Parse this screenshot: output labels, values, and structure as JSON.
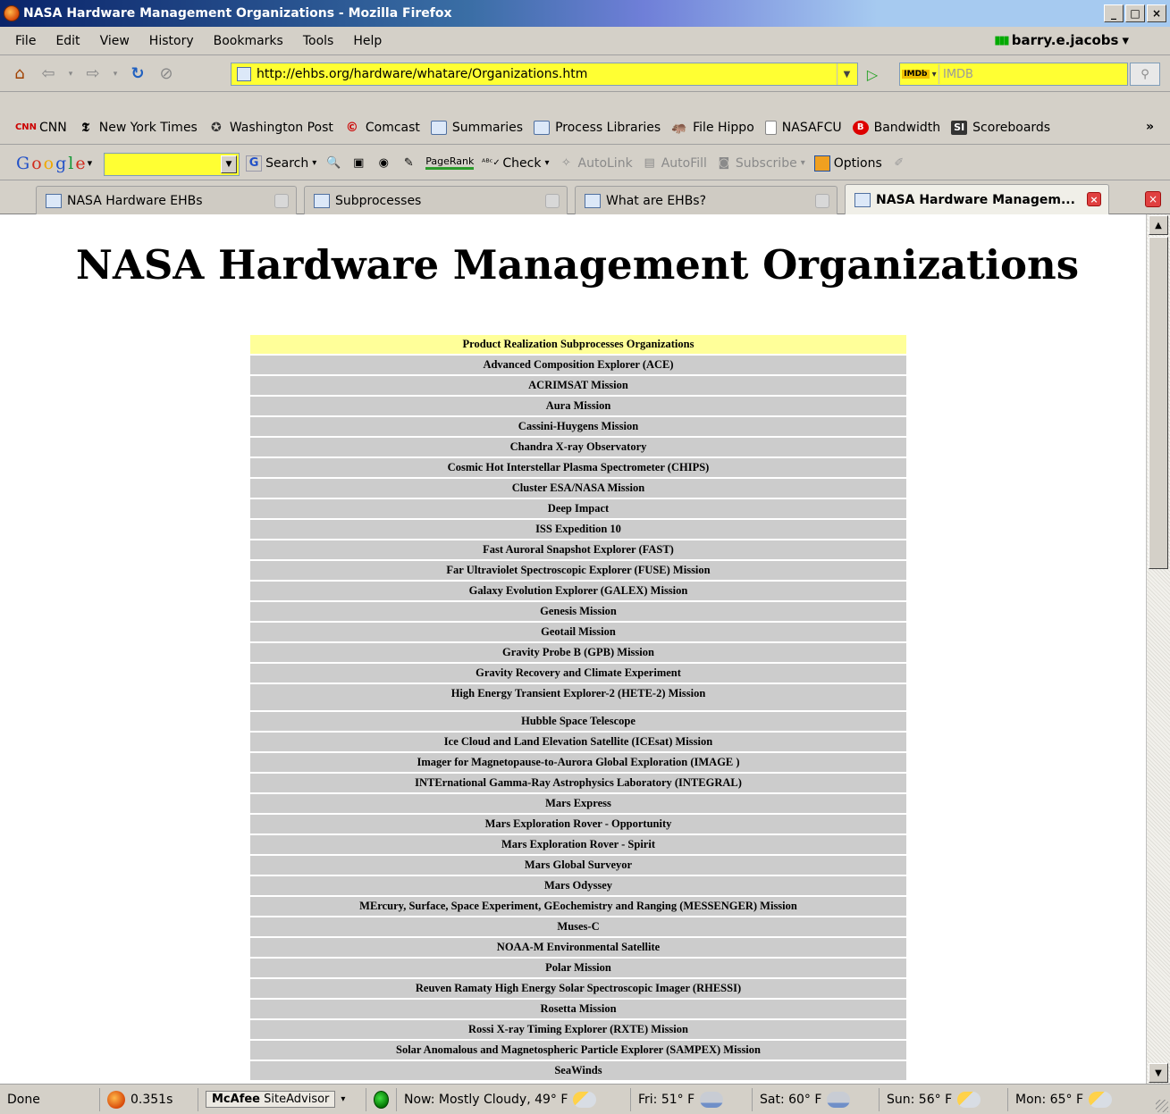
{
  "window": {
    "title": "NASA Hardware Management Organizations - Mozilla Firefox",
    "buttons": {
      "minimize": "_",
      "maximize": "□",
      "close": "×"
    }
  },
  "menubar": {
    "items": [
      "File",
      "Edit",
      "View",
      "History",
      "Bookmarks",
      "Tools",
      "Help"
    ],
    "user": "barry.e.jacobs"
  },
  "navbar": {
    "url": "http://ehbs.org/hardware/whatare/Organizations.htm",
    "search_placeholder": "IMDB",
    "search_engine_label": "IMDb"
  },
  "bookmarks": {
    "items": [
      {
        "label": "CNN",
        "icon": "cnn-icon"
      },
      {
        "label": "New York Times",
        "icon": "nyt-icon"
      },
      {
        "label": "Washington Post",
        "icon": "washington-post-icon"
      },
      {
        "label": "Comcast",
        "icon": "comcast-icon"
      },
      {
        "label": "Summaries",
        "icon": "page-icon"
      },
      {
        "label": "Process Libraries",
        "icon": "page-icon"
      },
      {
        "label": "File Hippo",
        "icon": "hippo-icon"
      },
      {
        "label": "NASAFCU",
        "icon": "document-icon"
      },
      {
        "label": "Bandwidth",
        "icon": "bandwidth-icon"
      },
      {
        "label": "Scoreboards",
        "icon": "si-icon"
      }
    ],
    "more": "»"
  },
  "google_toolbar": {
    "logo": [
      "G",
      "o",
      "o",
      "g",
      "l",
      "e"
    ],
    "search_label": "Search",
    "pagerank_label": "PageRank",
    "check_label": "Check",
    "autolink_label": "AutoLink",
    "autofill_label": "AutoFill",
    "subscribe_label": "Subscribe",
    "options_label": "Options"
  },
  "tabs": [
    {
      "label": "NASA Hardware EHBs",
      "active": false
    },
    {
      "label": "Subprocesses",
      "active": false
    },
    {
      "label": "What are EHBs?",
      "active": false
    },
    {
      "label": "NASA Hardware Managem...",
      "active": true
    }
  ],
  "page": {
    "title": "NASA Hardware Management Organizations",
    "table_header": "Product Realization Subprocesses Organizations",
    "organizations": [
      "Advanced Composition Explorer (ACE)",
      "ACRIMSAT Mission",
      "Aura Mission",
      "Cassini-Huygens Mission",
      "Chandra X-ray Observatory",
      "Cosmic Hot Interstellar Plasma Spectrometer (CHIPS)",
      "Cluster ESA/NASA Mission",
      "Deep Impact",
      "ISS Expedition 10",
      "Fast Auroral Snapshot Explorer (FAST)",
      "Far Ultraviolet Spectroscopic Explorer (FUSE) Mission",
      "Galaxy Evolution Explorer (GALEX) Mission",
      "Genesis Mission",
      "Geotail Mission",
      "Gravity Probe B (GPB) Mission",
      "Gravity Recovery and Climate Experiment",
      "High Energy Transient Explorer-2 (HETE-2) Mission",
      "Hubble Space Telescope",
      "Ice Cloud and Land Elevation Satellite (ICEsat) Mission",
      "Imager for Magnetopause-to-Aurora Global Exploration (IMAGE )",
      "INTErnational Gamma-Ray Astrophysics Laboratory (INTEGRAL)",
      "Mars Express",
      "Mars Exploration Rover - Opportunity",
      "Mars Exploration Rover - Spirit",
      "Mars Global Surveyor",
      "Mars Odyssey",
      "MErcury, Surface, Space Experiment, GEochemistry and Ranging (MESSENGER) Mission",
      "Muses-C",
      "NOAA-M Environmental Satellite",
      "Polar Mission",
      "Reuven Ramaty High Energy Solar Spectroscopic Imager (RHESSI)",
      "Rosetta Mission",
      "Rossi X-ray Timing Explorer (RXTE) Mission",
      "Solar Anomalous and Magnetospheric Particle Explorer (SAMPEX) Mission",
      "SeaWinds"
    ]
  },
  "statusbar": {
    "status": "Done",
    "timer": "0.351s",
    "siteadvisor_brand": "McAfee",
    "siteadvisor_product": "SiteAdvisor",
    "weather_now": "Now: Mostly Cloudy, 49° F",
    "forecast": [
      {
        "label": "Fri: 51° F",
        "icon": "rain-cloud-icon"
      },
      {
        "label": "Sat: 60° F",
        "icon": "rain-cloud-icon"
      },
      {
        "label": "Sun: 56° F",
        "icon": "partly-sunny-icon"
      },
      {
        "label": "Mon: 65° F",
        "icon": "partly-sunny-icon"
      }
    ]
  }
}
